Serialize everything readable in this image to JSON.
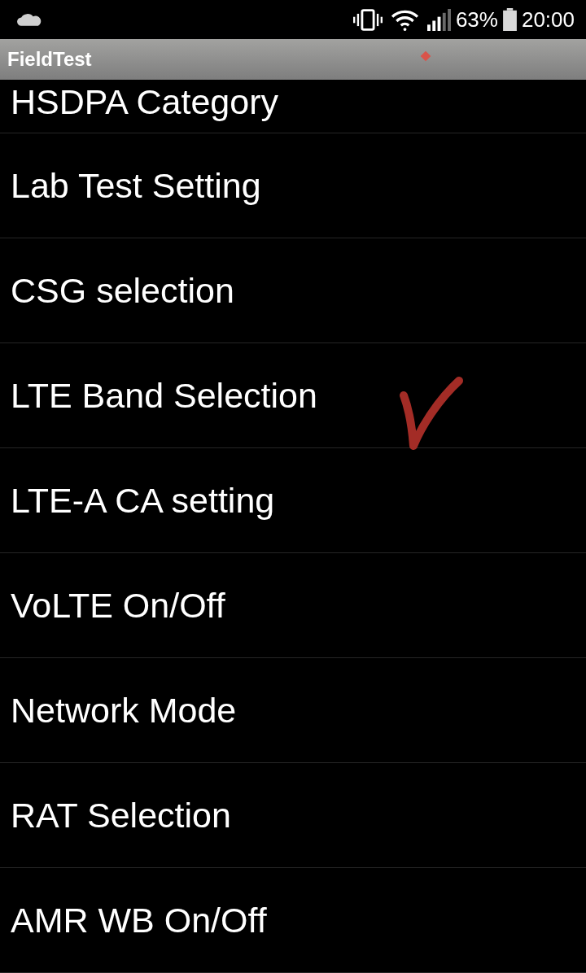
{
  "status_bar": {
    "battery": "63%",
    "time": "20:00"
  },
  "app_bar": {
    "title": "FieldTest"
  },
  "menu": {
    "items": [
      {
        "label": "HSDPA Category",
        "checked": false
      },
      {
        "label": "Lab Test Setting",
        "checked": false
      },
      {
        "label": "CSG selection",
        "checked": false
      },
      {
        "label": "LTE Band Selection",
        "checked": true
      },
      {
        "label": "LTE-A CA setting",
        "checked": false
      },
      {
        "label": "VoLTE On/Off",
        "checked": false
      },
      {
        "label": "Network Mode",
        "checked": false
      },
      {
        "label": "RAT Selection",
        "checked": false
      },
      {
        "label": "AMR WB On/Off",
        "checked": false
      }
    ]
  }
}
